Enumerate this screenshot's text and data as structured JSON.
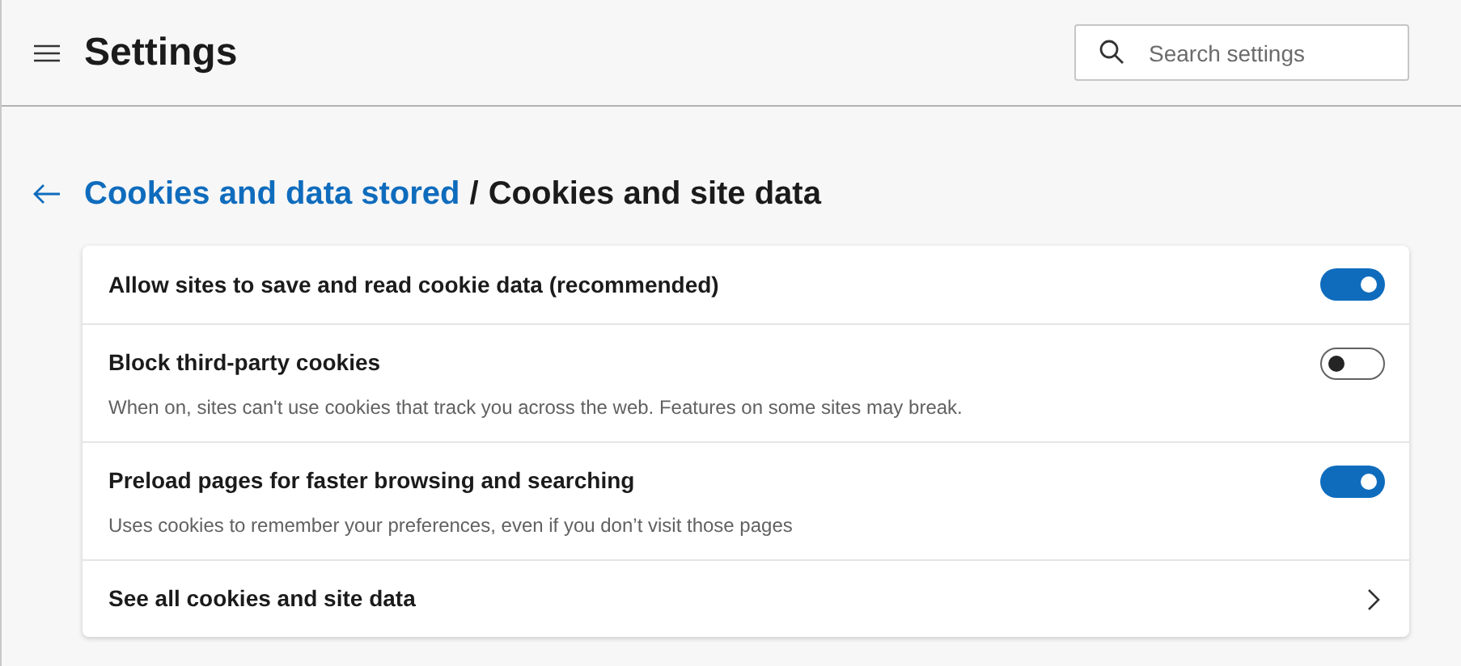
{
  "header": {
    "title": "Settings",
    "search": {
      "placeholder": "Search settings"
    }
  },
  "breadcrumb": {
    "parent": "Cookies and data stored",
    "separator": "/",
    "current": "Cookies and site data"
  },
  "settings": [
    {
      "kind": "toggle",
      "label": "Allow sites to save and read cookie data (recommended)",
      "on": true
    },
    {
      "kind": "toggle",
      "label": "Block third-party cookies",
      "description": "When on, sites can't use cookies that track you across the web. Features on some sites may break.",
      "on": false
    },
    {
      "kind": "toggle",
      "label": "Preload pages for faster browsing and searching",
      "description": "Uses cookies to remember your preferences, even if you don’t visit those pages",
      "on": true
    },
    {
      "kind": "link",
      "label": "See all cookies and site data"
    }
  ]
}
